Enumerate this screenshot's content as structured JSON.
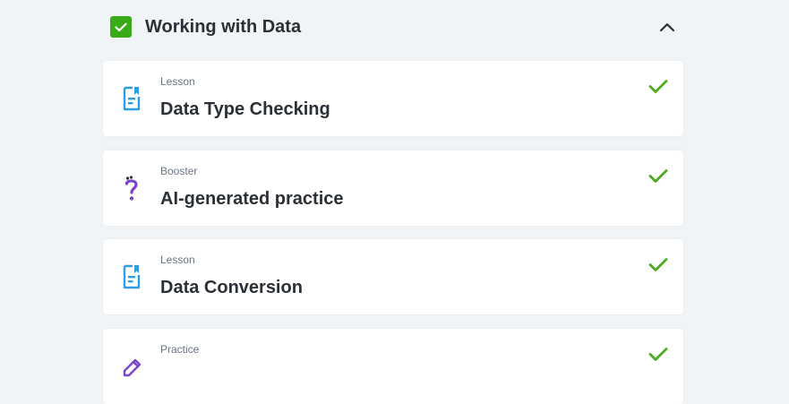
{
  "section": {
    "title": "Working with Data",
    "completed": true,
    "expanded": true
  },
  "items": [
    {
      "type": "Lesson",
      "title": "Data Type Checking",
      "icon": "lesson-icon",
      "completed": true
    },
    {
      "type": "Booster",
      "title": "AI-generated practice",
      "icon": "question-mark-icon",
      "completed": true
    },
    {
      "type": "Lesson",
      "title": "Data Conversion",
      "icon": "lesson-icon",
      "completed": true
    },
    {
      "type": "Practice",
      "title": "",
      "icon": "pencil-icon",
      "completed": true
    }
  ],
  "colors": {
    "success_green": "#3aaa16",
    "check_green": "#4cab1f",
    "lesson_blue": "#2d9ee0",
    "booster_purple": "#7a45c8",
    "text_dark": "#2b2f36",
    "text_muted": "#6a7582"
  }
}
